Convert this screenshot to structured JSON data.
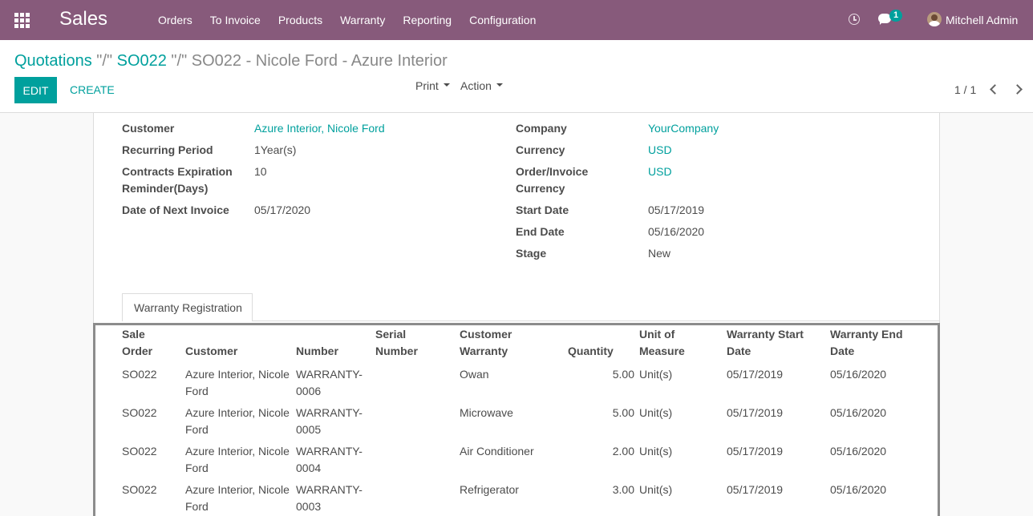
{
  "navbar": {
    "app_name": "Sales",
    "menu": [
      "Orders",
      "To Invoice",
      "Products",
      "Warranty",
      "Reporting",
      "Configuration"
    ],
    "chat_count": "1",
    "user": "Mitchell Admin",
    "color": "#875a7b"
  },
  "control_panel": {
    "breadcrumb_quotations": "Quotations",
    "breadcrumb_sep1": " \"/\" ",
    "breadcrumb_so": "SO022",
    "breadcrumb_sep2": " \"/\" ",
    "breadcrumb_current": "SO022 - Nicole Ford - Azure Interior",
    "edit_label": "EDIT",
    "create_label": "CREATE",
    "print_label": "Print",
    "action_label": "Action",
    "pager": "1 / 1",
    "accent": "#00a09d"
  },
  "form": {
    "left": [
      {
        "label": "Customer",
        "value": "Azure Interior, Nicole Ford"
      },
      {
        "label": "Recurring Period",
        "value": "1Year(s)"
      },
      {
        "label": "Contracts Expiration Reminder(Days)",
        "value": "10"
      },
      {
        "label": "Date of Next Invoice",
        "value": "05/17/2020"
      }
    ],
    "right": [
      {
        "label": "Company",
        "value": "YourCompany"
      },
      {
        "label": "Currency",
        "value": "USD"
      },
      {
        "label": "Order/Invoice Currency",
        "value": "USD"
      },
      {
        "label": "Start Date",
        "value": "05/17/2019"
      },
      {
        "label": "End Date",
        "value": "05/16/2020"
      },
      {
        "label": "Stage",
        "value": "New"
      }
    ]
  },
  "tab": {
    "label": "Warranty Registration"
  },
  "table": {
    "headers": {
      "sale_order": "Sale Order",
      "customer": "Customer",
      "number": "Number",
      "serial_number": "Serial Number",
      "customer_warranty": "Customer Warranty",
      "quantity": "Quantity",
      "uom": "Unit of Measure",
      "warranty_start": "Warranty Start Date",
      "warranty_end": "Warranty End Date"
    },
    "rows": [
      {
        "sale_order": "SO022",
        "customer": "Azure Interior, Nicole Ford",
        "number": "WARRANTY-0006",
        "serial_number": "",
        "customer_warranty": "Owan",
        "quantity": "5.00",
        "uom": "Unit(s)",
        "start": "05/17/2019",
        "end": "05/16/2020"
      },
      {
        "sale_order": "SO022",
        "customer": "Azure Interior, Nicole Ford",
        "number": "WARRANTY-0005",
        "serial_number": "",
        "customer_warranty": "Microwave",
        "quantity": "5.00",
        "uom": "Unit(s)",
        "start": "05/17/2019",
        "end": "05/16/2020"
      },
      {
        "sale_order": "SO022",
        "customer": "Azure Interior, Nicole Ford",
        "number": "WARRANTY-0004",
        "serial_number": "",
        "customer_warranty": "Air Conditioner",
        "quantity": "2.00",
        "uom": "Unit(s)",
        "start": "05/17/2019",
        "end": "05/16/2020"
      },
      {
        "sale_order": "SO022",
        "customer": "Azure Interior, Nicole Ford",
        "number": "WARRANTY-0003",
        "serial_number": "",
        "customer_warranty": "Refrigerator",
        "quantity": "3.00",
        "uom": "Unit(s)",
        "start": "05/17/2019",
        "end": "05/16/2020"
      }
    ]
  }
}
